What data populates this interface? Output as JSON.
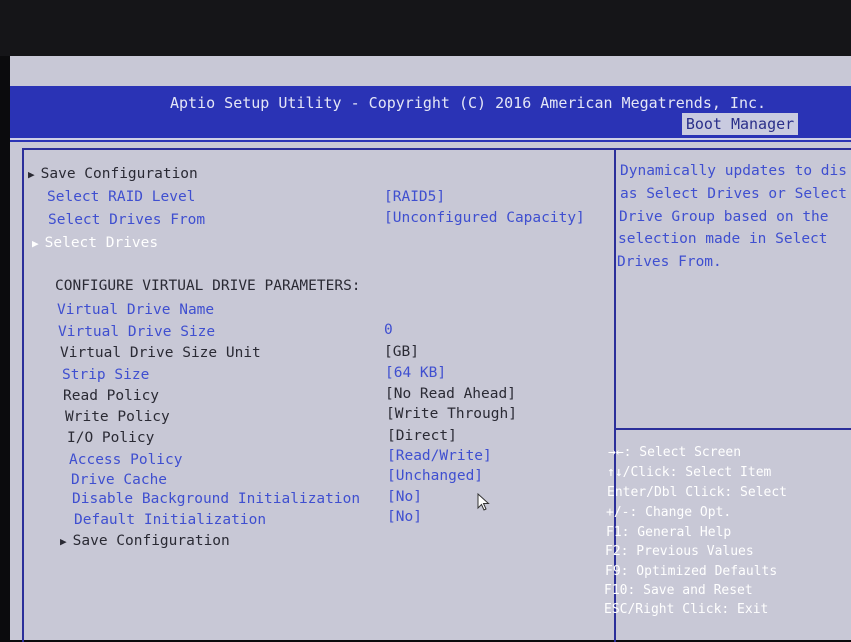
{
  "header": {
    "title": "Aptio Setup Utility - Copyright (C) 2016 American Megatrends, Inc.",
    "tab": "Boot Manager"
  },
  "menu": {
    "save_top": "Save Configuration",
    "raid_label": "Select RAID Level",
    "raid_value": "[RAID5]",
    "drives_from_label": "Select Drives From",
    "drives_from_value": "[Unconfigured Capacity]",
    "select_drives": "Select Drives",
    "section": "CONFIGURE VIRTUAL DRIVE PARAMETERS:",
    "vd_name": "Virtual Drive Name",
    "vd_size_label": "Virtual Drive Size",
    "vd_size_value": "0",
    "vd_unit_label": "Virtual Drive Size Unit",
    "vd_unit_value": "[GB]",
    "strip_label": "Strip Size",
    "strip_value": "[64 KB]",
    "read_label": "Read Policy",
    "read_value": "[No Read Ahead]",
    "write_label": "Write Policy",
    "write_value": "[Write Through]",
    "io_label": "I/O Policy",
    "io_value": "[Direct]",
    "access_label": "Access Policy",
    "access_value": "[Read/Write]",
    "cache_label": "Drive Cache",
    "cache_value": "[Unchanged]",
    "bgi_label": "Disable Background Initialization",
    "bgi_value": "[No]",
    "init_label": "Default Initialization",
    "init_value": "[No]",
    "save_bottom": "Save Configuration"
  },
  "help": {
    "lines": [
      "Dynamically updates to dis",
      "as Select Drives or Select",
      "Drive Group based on the",
      "selection made in Select",
      "Drives From."
    ]
  },
  "keys": [
    "→←: Select Screen",
    "↑↓/Click: Select Item",
    "Enter/Dbl Click: Select",
    "+/-: Change Opt.",
    "F1: General Help",
    "F2: Previous Values",
    "F9: Optimized Defaults",
    "F10: Save and Reset",
    "ESC/Right Click: Exit"
  ],
  "colors": {
    "header_bg": "#2a33b5",
    "screen_bg": "#c8c8d6",
    "value_blue": "#3f4fd0"
  }
}
